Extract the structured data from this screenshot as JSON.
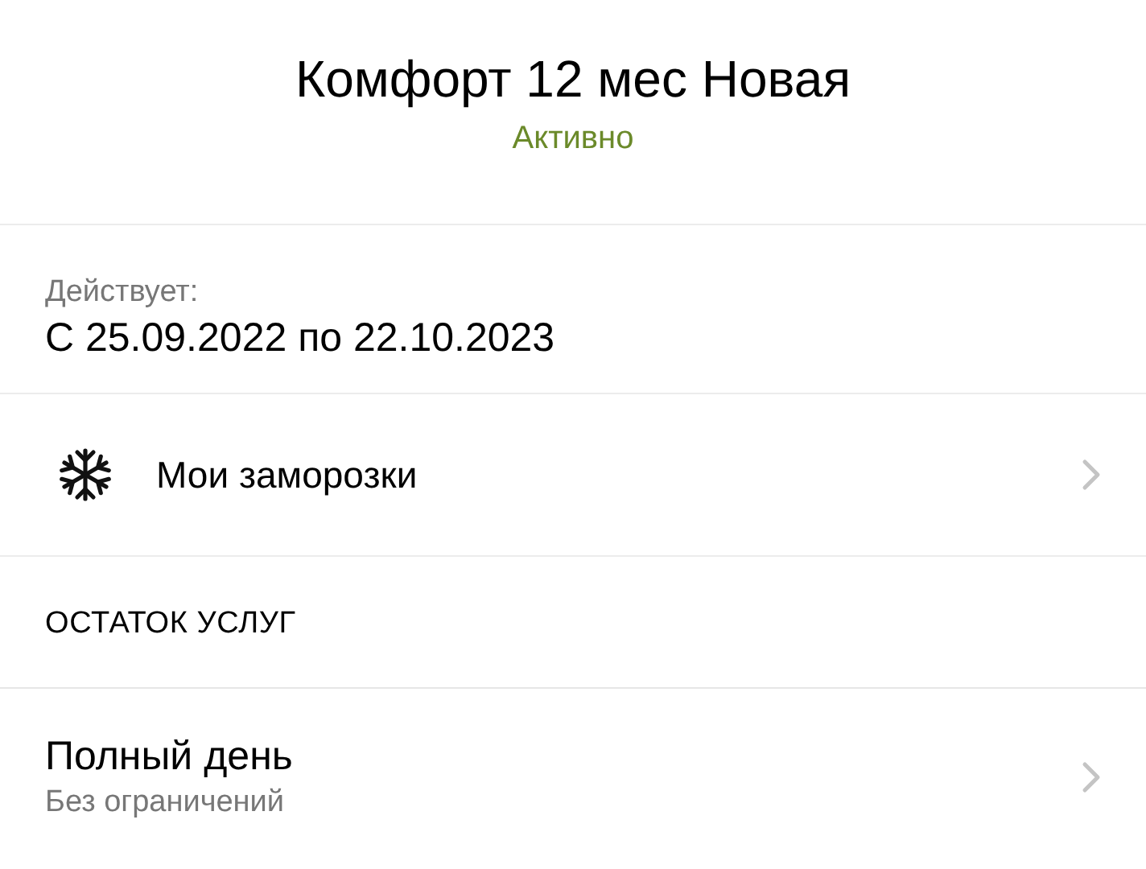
{
  "header": {
    "title": "Комфорт 12 мес Новая",
    "status": "Активно"
  },
  "validity": {
    "label": "Действует:",
    "value": "С 25.09.2022 по 22.10.2023"
  },
  "freezes": {
    "label": "Мои заморозки"
  },
  "services_section": {
    "title": "ОСТАТОК УСЛУГ"
  },
  "services": [
    {
      "name": "Полный день",
      "limit": "Без ограничений"
    }
  ]
}
